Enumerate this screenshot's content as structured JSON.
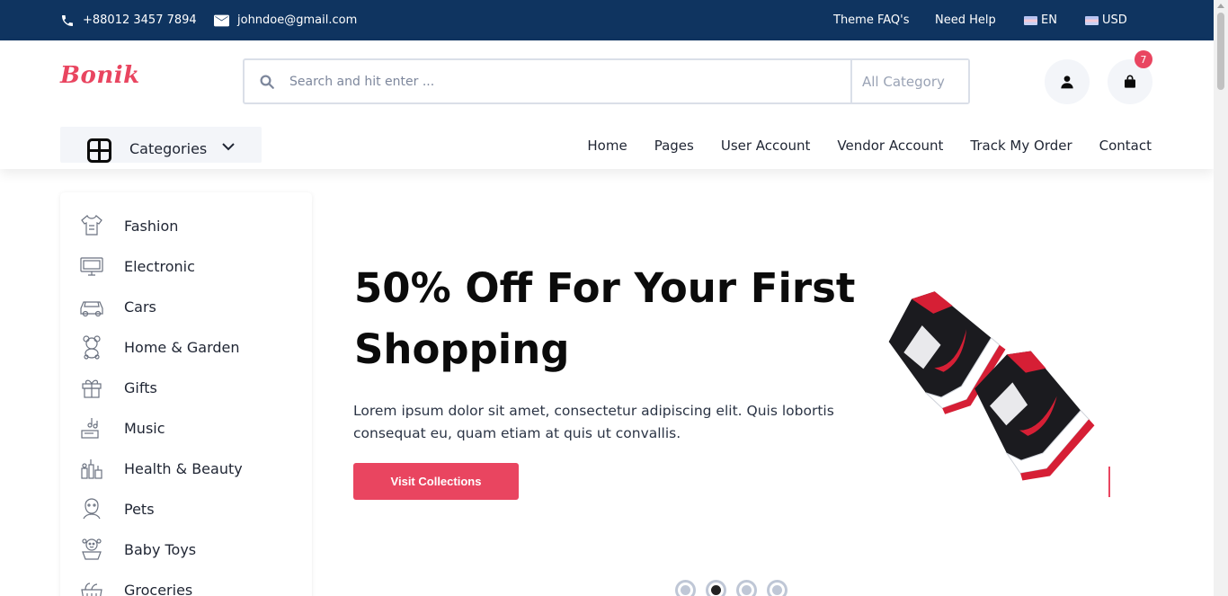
{
  "topbar": {
    "phone": "+88012 3457 7894",
    "email": "johndoe@gmail.com",
    "faq": "Theme FAQ's",
    "help": "Need Help",
    "language": "EN",
    "currency": "USD"
  },
  "header": {
    "logo": "Bonik",
    "search_placeholder": "Search and hit enter ...",
    "category_select": "All Category",
    "cart_count": "7",
    "categories_label": "Categories",
    "nav": [
      "Home",
      "Pages",
      "User Account",
      "Vendor Account",
      "Track My Order",
      "Contact"
    ]
  },
  "sidebar": {
    "items": [
      {
        "label": "Fashion",
        "icon": "dress-icon"
      },
      {
        "label": "Electronic",
        "icon": "monitor-icon"
      },
      {
        "label": "Cars",
        "icon": "car-icon"
      },
      {
        "label": "Home & Garden",
        "icon": "teddy-bear-icon"
      },
      {
        "label": "Gifts",
        "icon": "gift-icon"
      },
      {
        "label": "Music",
        "icon": "music-icon"
      },
      {
        "label": "Health & Beauty",
        "icon": "cosmetics-icon"
      },
      {
        "label": "Pets",
        "icon": "pet-icon"
      },
      {
        "label": "Baby Toys",
        "icon": "baby-icon"
      },
      {
        "label": "Groceries",
        "icon": "groceries-icon"
      }
    ]
  },
  "hero": {
    "title_line1": "50% Off For Your First",
    "title_line2": "Shopping",
    "text": "Lorem ipsum dolor sit amet, consectetur adipiscing elit. Quis lobortis consequat eu, quam etiam at quis ut convallis.",
    "button": "Visit Collections",
    "slide_count": 4,
    "active_slide": 2
  },
  "colors": {
    "topbar": "#0f3460",
    "accent": "#e94560",
    "light_bg": "#f3f5f9"
  }
}
